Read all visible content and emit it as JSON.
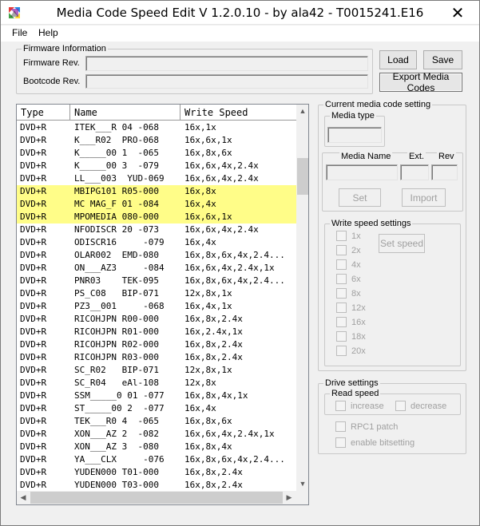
{
  "window": {
    "title": "Media Code Speed Edit V 1.2.0.10 - by ala42 - T0015241.E16",
    "close_glyph": "✕"
  },
  "menu": {
    "file": "File",
    "help": "Help"
  },
  "firmware": {
    "legend": "Firmware Information",
    "firmware_rev_label": "Firmware Rev.",
    "bootcode_rev_label": "Bootcode Rev.",
    "firmware_rev_value": "",
    "bootcode_rev_value": ""
  },
  "buttons": {
    "load": "Load",
    "save": "Save",
    "export": "Export Media Codes",
    "set": "Set",
    "import": "Import",
    "set_speed": "Set speed"
  },
  "list": {
    "columns": [
      "Type",
      "Name",
      "Write Speed"
    ],
    "rows": [
      {
        "type": "DVD+R",
        "name": "ITEK___R 04 -068",
        "speed": "16x,1x",
        "highlight": false
      },
      {
        "type": "DVD+R",
        "name": "K___R02  PRO-068",
        "speed": "16x,6x,1x",
        "highlight": false
      },
      {
        "type": "DVD+R",
        "name": "K_____00 1  -065",
        "speed": "16x,8x,6x",
        "highlight": false
      },
      {
        "type": "DVD+R",
        "name": "K_____00 3  -079",
        "speed": "16x,6x,4x,2.4x",
        "highlight": false
      },
      {
        "type": "DVD+R",
        "name": "LL___003  YUD-069",
        "speed": "16x,6x,4x,2.4x",
        "highlight": false
      },
      {
        "type": "DVD+R",
        "name": "MBIPG101 R05-000",
        "speed": "16x,8x",
        "highlight": true
      },
      {
        "type": "DVD+R",
        "name": "MC MAG_F 01 -084",
        "speed": "16x,4x",
        "highlight": true
      },
      {
        "type": "DVD+R",
        "name": "MPOMEDIA 080-000",
        "speed": "16x,6x,1x",
        "highlight": true
      },
      {
        "type": "DVD+R",
        "name": "NFODISCR 20 -073",
        "speed": "16x,6x,4x,2.4x",
        "highlight": false
      },
      {
        "type": "DVD+R",
        "name": "ODISCR16     -079",
        "speed": "16x,4x",
        "highlight": false
      },
      {
        "type": "DVD+R",
        "name": "OLAR002  EMD-080",
        "speed": "16x,8x,6x,4x,2.4...",
        "highlight": false
      },
      {
        "type": "DVD+R",
        "name": "ON___AZ3     -084",
        "speed": "16x,6x,4x,2.4x,1x",
        "highlight": false
      },
      {
        "type": "DVD+R",
        "name": "PNR03    TEK-095",
        "speed": "16x,8x,6x,4x,2.4...",
        "highlight": false
      },
      {
        "type": "DVD+R",
        "name": "PS_C08   BIP-071",
        "speed": "12x,8x,1x",
        "highlight": false
      },
      {
        "type": "DVD+R",
        "name": "PZ3__001     -068",
        "speed": "16x,4x,1x",
        "highlight": false
      },
      {
        "type": "DVD+R",
        "name": "RICOHJPN R00-000",
        "speed": "16x,8x,2.4x",
        "highlight": false
      },
      {
        "type": "DVD+R",
        "name": "RICOHJPN R01-000",
        "speed": "16x,2.4x,1x",
        "highlight": false
      },
      {
        "type": "DVD+R",
        "name": "RICOHJPN R02-000",
        "speed": "16x,8x,2.4x",
        "highlight": false
      },
      {
        "type": "DVD+R",
        "name": "RICOHJPN R03-000",
        "speed": "16x,8x,2.4x",
        "highlight": false
      },
      {
        "type": "DVD+R",
        "name": "SC_R02   BIP-071",
        "speed": "12x,8x,1x",
        "highlight": false
      },
      {
        "type": "DVD+R",
        "name": "SC_R04   eAl-108",
        "speed": "12x,8x",
        "highlight": false
      },
      {
        "type": "DVD+R",
        "name": "SSM_____0 01 -077",
        "speed": "16x,8x,4x,1x",
        "highlight": false
      },
      {
        "type": "DVD+R",
        "name": "ST_____00 2  -077",
        "speed": "16x,4x",
        "highlight": false
      },
      {
        "type": "DVD+R",
        "name": "TEK___R0 4  -065",
        "speed": "16x,8x,6x",
        "highlight": false
      },
      {
        "type": "DVD+R",
        "name": "XON___AZ 2  -082",
        "speed": "16x,6x,4x,2.4x,1x",
        "highlight": false
      },
      {
        "type": "DVD+R",
        "name": "XON___AZ 3  -080",
        "speed": "16x,8x,4x",
        "highlight": false
      },
      {
        "type": "DVD+R",
        "name": "YA___CLX     -076",
        "speed": "16x,8x,6x,4x,2.4...",
        "highlight": false
      },
      {
        "type": "DVD+R",
        "name": "YUDEN000 T01-000",
        "speed": "16x,8x,2.4x",
        "highlight": false
      },
      {
        "type": "DVD+R",
        "name": "YUDEN000 T03-000",
        "speed": "16x,8x,2.4x",
        "highlight": false
      }
    ],
    "highlight_color": "#fffd88"
  },
  "current_media": {
    "legend": "Current media code setting",
    "media_type_legend": "Media type",
    "media_name_label": "Media Name",
    "ext_label": "Ext.",
    "rev_label": "Rev"
  },
  "write_speed": {
    "legend": "Write speed settings",
    "speeds": [
      "1x",
      "2x",
      "4x",
      "6x",
      "8x",
      "12x",
      "16x",
      "18x",
      "20x"
    ]
  },
  "drive": {
    "legend": "Drive settings",
    "read_speed_legend": "Read speed",
    "increase": "increase",
    "decrease": "decrease",
    "rpc1": "RPC1 patch",
    "bitsetting": "enable bitsetting"
  },
  "icons": {
    "app": "app-icon",
    "close": "close-icon",
    "scroll_up": "scroll-up-arrow-icon",
    "scroll_down": "scroll-down-arrow-icon",
    "scroll_left": "scroll-left-arrow-icon",
    "scroll_right": "scroll-right-arrow-icon"
  }
}
